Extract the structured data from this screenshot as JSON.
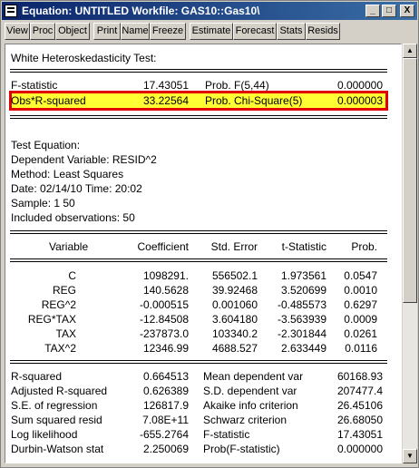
{
  "window": {
    "title": "Equation: UNTITLED   Workfile: GAS10::Gas10\\",
    "minimize": "_",
    "maximize": "□",
    "close": "X"
  },
  "toolbar": [
    "View",
    "Proc",
    "Object",
    "Print",
    "Name",
    "Freeze",
    "Estimate",
    "Forecast",
    "Stats",
    "Resids"
  ],
  "test": {
    "title": "White Heteroskedasticity Test:",
    "rows": [
      {
        "label": "F-statistic",
        "value": "17.43051",
        "plabel": "Prob. F(5,44)",
        "pvalue": "0.000000"
      },
      {
        "label": "Obs*R-squared",
        "value": "33.22564",
        "plabel": "Prob. Chi-Square(5)",
        "pvalue": "0.000003"
      }
    ]
  },
  "equation": {
    "lines": [
      "Test Equation:",
      "Dependent Variable: RESID^2",
      "Method: Least Squares",
      "Date: 02/14/10   Time: 20:02",
      "Sample: 1 50",
      "Included observations: 50"
    ]
  },
  "coef_table": {
    "headers": [
      "Variable",
      "Coefficient",
      "Std. Error",
      "t-Statistic",
      "Prob."
    ],
    "rows": [
      [
        "C",
        "1098291.",
        "556502.1",
        "1.973561",
        "0.0547"
      ],
      [
        "REG",
        "140.5628",
        "39.92468",
        "3.520699",
        "0.0010"
      ],
      [
        "REG^2",
        "-0.000515",
        "0.001060",
        "-0.485573",
        "0.6297"
      ],
      [
        "REG*TAX",
        "-12.84508",
        "3.604180",
        "-3.563939",
        "0.0009"
      ],
      [
        "TAX",
        "-237873.0",
        "103340.2",
        "-2.301844",
        "0.0261"
      ],
      [
        "TAX^2",
        "12346.99",
        "4688.527",
        "2.633449",
        "0.0116"
      ]
    ]
  },
  "stats": [
    [
      "R-squared",
      "0.664513",
      "Mean dependent var",
      "60168.93"
    ],
    [
      "Adjusted R-squared",
      "0.626389",
      "S.D. dependent var",
      "207477.4"
    ],
    [
      "S.E. of regression",
      "126817.9",
      "Akaike info criterion",
      "26.45106"
    ],
    [
      "Sum squared resid",
      "7.08E+11",
      "Schwarz criterion",
      "26.68050"
    ],
    [
      "Log likelihood",
      "-655.2764",
      "F-statistic",
      "17.43051"
    ],
    [
      "Durbin-Watson stat",
      "2.250069",
      "Prob(F-statistic)",
      "0.000000"
    ]
  ],
  "scrollbar": {
    "up": "▲",
    "down": "▼"
  }
}
